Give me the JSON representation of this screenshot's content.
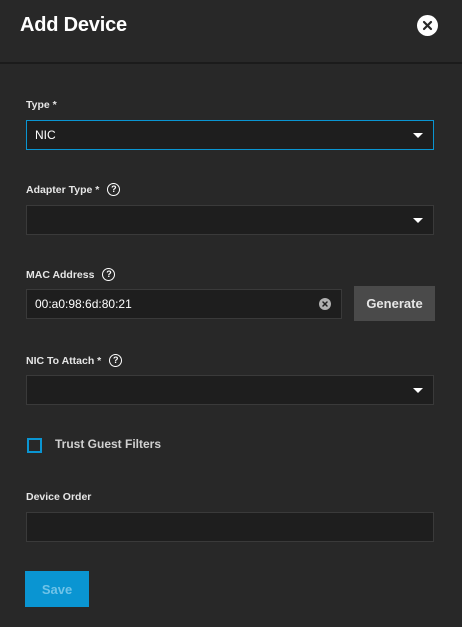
{
  "dialog": {
    "title": "Add Device"
  },
  "form": {
    "type": {
      "label": "Type *",
      "value": "NIC"
    },
    "adapter_type": {
      "label": "Adapter Type *",
      "value": ""
    },
    "mac_address": {
      "label": "MAC Address",
      "value": "00:a0:98:6d:80:21"
    },
    "generate_label": "Generate",
    "nic_to_attach": {
      "label": "NIC To Attach *",
      "value": ""
    },
    "trust_guest_filters": {
      "label": "Trust Guest Filters",
      "checked": false
    },
    "device_order": {
      "label": "Device Order",
      "value": ""
    },
    "help_glyph": "?",
    "save_label": "Save"
  },
  "colors": {
    "background": "#282828",
    "field_background": "#1e1e1e",
    "accent": "#0a95d2",
    "button_grey": "#4a4a4a"
  },
  "icons": [
    "close-icon",
    "help-icon",
    "dropdown-arrow-icon",
    "clear-icon",
    "checkbox-icon"
  ]
}
